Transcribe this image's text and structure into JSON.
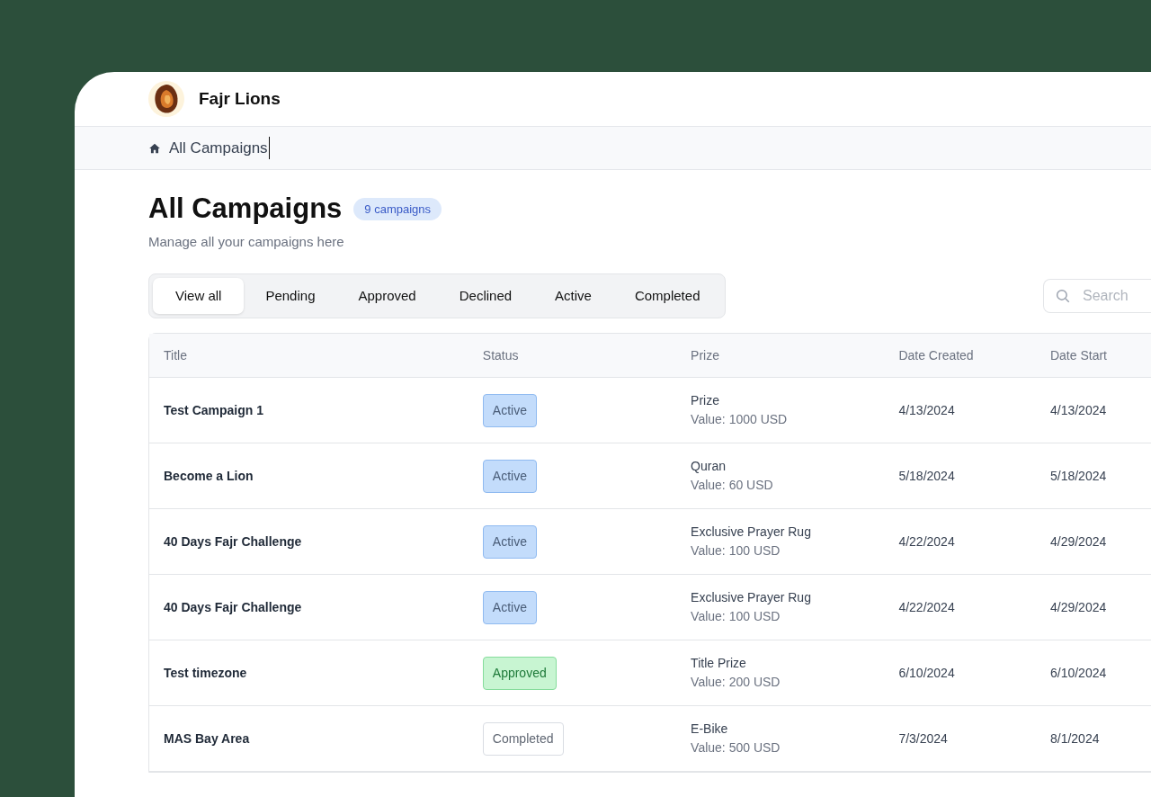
{
  "brand": {
    "name": "Fajr Lions"
  },
  "breadcrumb": {
    "label": "All Campaigns"
  },
  "page": {
    "title": "All Campaigns",
    "count_badge": "9 campaigns",
    "subtitle": "Manage all your campaigns here"
  },
  "tabs": [
    {
      "label": "View all",
      "selected": true
    },
    {
      "label": "Pending",
      "selected": false
    },
    {
      "label": "Approved",
      "selected": false
    },
    {
      "label": "Declined",
      "selected": false
    },
    {
      "label": "Active",
      "selected": false
    },
    {
      "label": "Completed",
      "selected": false
    }
  ],
  "search": {
    "placeholder": "Search"
  },
  "table": {
    "columns": [
      "Title",
      "Status",
      "Prize",
      "Date Created",
      "Date Start"
    ],
    "rows": [
      {
        "title": "Test Campaign 1",
        "status": {
          "label": "Active",
          "kind": "active"
        },
        "prize": "Prize",
        "value": "Value: 1000 USD",
        "date_created": "4/13/2024",
        "date_start": "4/13/2024"
      },
      {
        "title": "Become a Lion",
        "status": {
          "label": "Active",
          "kind": "active"
        },
        "prize": "Quran",
        "value": "Value: 60 USD",
        "date_created": "5/18/2024",
        "date_start": "5/18/2024"
      },
      {
        "title": "40 Days Fajr Challenge",
        "status": {
          "label": "Active",
          "kind": "active"
        },
        "prize": "Exclusive Prayer Rug",
        "value": "Value: 100 USD",
        "date_created": "4/22/2024",
        "date_start": "4/29/2024"
      },
      {
        "title": "40 Days Fajr Challenge",
        "status": {
          "label": "Active",
          "kind": "active"
        },
        "prize": "Exclusive Prayer Rug",
        "value": "Value: 100 USD",
        "date_created": "4/22/2024",
        "date_start": "4/29/2024"
      },
      {
        "title": "Test timezone",
        "status": {
          "label": "Approved",
          "kind": "approved"
        },
        "prize": "Title Prize",
        "value": "Value: 200 USD",
        "date_created": "6/10/2024",
        "date_start": "6/10/2024"
      },
      {
        "title": "MAS Bay Area",
        "status": {
          "label": "Completed",
          "kind": "completed"
        },
        "prize": "E-Bike",
        "value": "Value: 500 USD",
        "date_created": "7/3/2024",
        "date_start": "8/1/2024"
      }
    ]
  }
}
